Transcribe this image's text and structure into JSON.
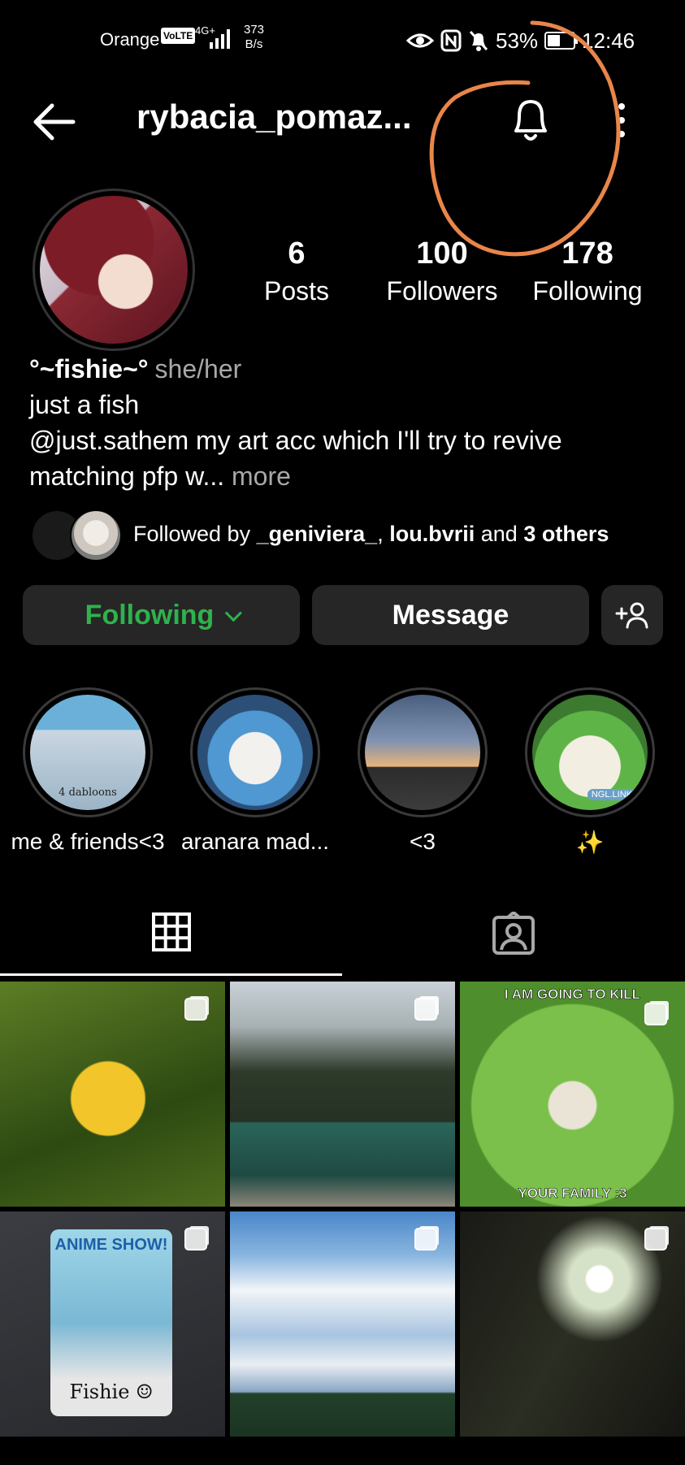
{
  "status_bar": {
    "carrier": "Orange",
    "volte": "VoLTE",
    "network": "4G+",
    "speed_value": "373",
    "speed_unit": "B/s",
    "battery": "53%",
    "battery_level": 0.53,
    "time": "12:46"
  },
  "header": {
    "username": "rybacia_pomaz..."
  },
  "stats": [
    {
      "value": "6",
      "label": "Posts"
    },
    {
      "value": "100",
      "label": "Followers"
    },
    {
      "value": "178",
      "label": "Following"
    }
  ],
  "bio": {
    "display_name": "°~fishie~°",
    "pronouns": "she/her",
    "line1": "just a fish",
    "line2": "@just.sathem my art acc which I'll try to revive",
    "line3": "matching pfp w...",
    "more": "more"
  },
  "followed_by": {
    "prefix": "Followed by",
    "user1": "_geniviera_",
    "separator": ",",
    "user2": "lou.bvrii",
    "and": "and",
    "others": "3 others"
  },
  "actions": {
    "following": "Following",
    "message": "Message"
  },
  "highlights": [
    {
      "label": "me & friends<3",
      "inner_text": "4 dabloons"
    },
    {
      "label": "aranara mad..."
    },
    {
      "label": "<3"
    },
    {
      "label": "✨",
      "inner_text": "NGL.LINK"
    }
  ],
  "posts": [
    {
      "id": "p1"
    },
    {
      "id": "p2"
    },
    {
      "id": "p3",
      "top_text": "I AM GOING TO KILL",
      "bottom_text": "YOUR FAMILY :3"
    },
    {
      "id": "p4",
      "card_title": "ANIME SHOW!",
      "card_name": "Fishie ☺"
    },
    {
      "id": "p5"
    },
    {
      "id": "p6"
    }
  ],
  "colors": {
    "background": "#000000",
    "button_bg": "#262626",
    "following_green": "#2fb24c",
    "muted_text": "#a8a8a8",
    "annotation_orange": "#e8864a"
  }
}
